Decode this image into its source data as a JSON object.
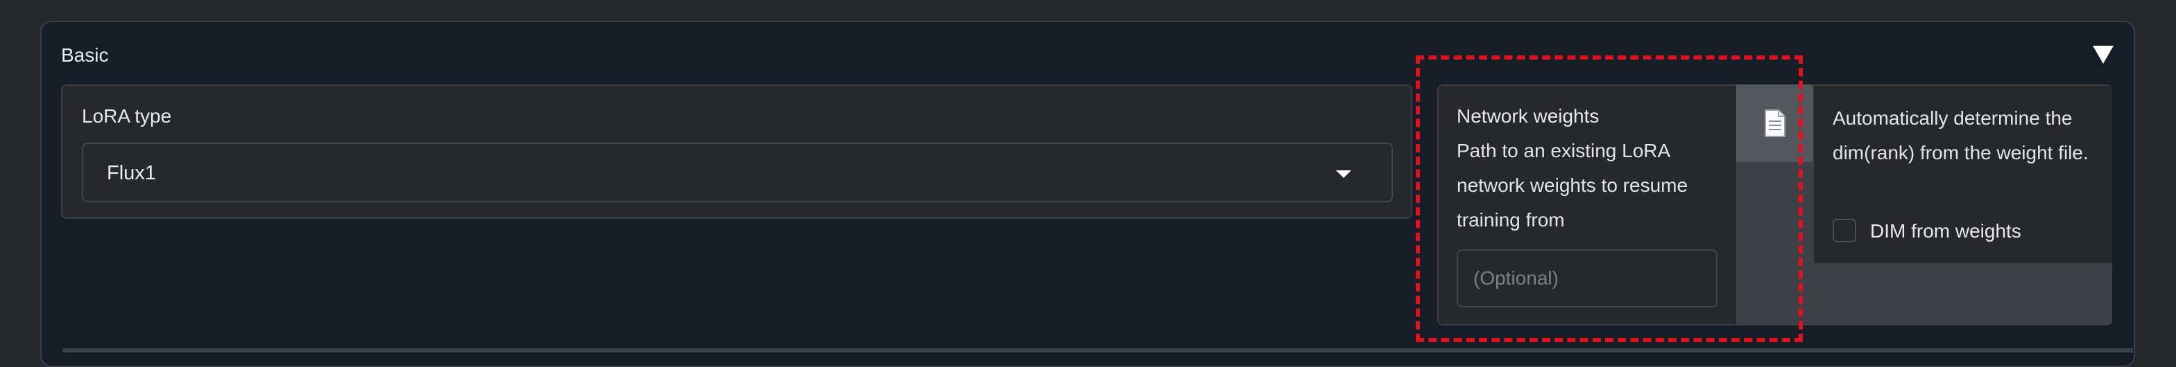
{
  "accordion": {
    "title": "Basic",
    "collapse_icon": "triangle-down-icon"
  },
  "lora_type": {
    "label": "LoRA type",
    "value": "Flux1",
    "dropdown_icon": "caret-down-icon"
  },
  "network_weights": {
    "label": "Network weights",
    "info": "Path to an existing LoRA network weights to resume training from",
    "placeholder": "(Optional)",
    "file_button_icon": "document-icon"
  },
  "dim_from_weights": {
    "info": "Automatically determine the dim(rank) from the weight file.",
    "checkbox_label": "DIM from weights",
    "checked": false
  },
  "colors": {
    "highlight": "#e3121a",
    "panel": "#27282c",
    "background": "#171d27"
  }
}
